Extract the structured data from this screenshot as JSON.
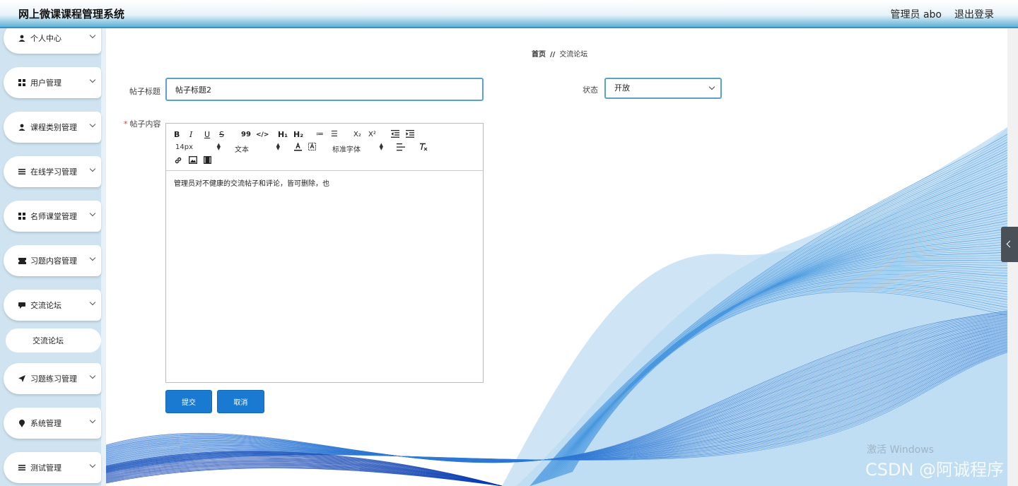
{
  "app_title": "网上微课课程管理系统",
  "header": {
    "user": "管理员 abo",
    "logout": "退出登录"
  },
  "sidebar": {
    "items": [
      {
        "label": "个人中心",
        "icon": "user-icon"
      },
      {
        "label": "用户管理",
        "icon": "grid-icon"
      },
      {
        "label": "课程类别管理",
        "icon": "user-icon"
      },
      {
        "label": "在线学习管理",
        "icon": "list-icon"
      },
      {
        "label": "名师课堂管理",
        "icon": "grid-icon"
      },
      {
        "label": "习题内容管理",
        "icon": "ticket-icon"
      },
      {
        "label": "交流论坛",
        "icon": "chat-icon"
      },
      {
        "label": "习题练习管理",
        "icon": "send-icon"
      },
      {
        "label": "系统管理",
        "icon": "pin-icon"
      },
      {
        "label": "测试管理",
        "icon": "list-icon"
      }
    ],
    "sub_item": "交流论坛"
  },
  "breadcrumb": {
    "home": "首页",
    "separator": "//",
    "current": "交流论坛"
  },
  "form": {
    "title_label": "帖子标题",
    "title_value": "帖子标题2",
    "status_label": "状态",
    "status_value": "开放",
    "content_label": "帖子内容",
    "required_mark": "*",
    "content_value": "管理员对不健康的交流帖子和评论，皆可删除，也"
  },
  "editor_toolbar": {
    "bold": "B",
    "italic": "I",
    "underline": "U",
    "strike": "S",
    "quote": "99",
    "code": "</>",
    "h1": "H₁",
    "h2": "H₂",
    "ordered_list": "≔",
    "bullet_list": "☰",
    "subscript": "X₂",
    "superscript": "X²",
    "font_size": "14px",
    "header_select": "文本",
    "font_family": "标准字体"
  },
  "buttons": {
    "submit": "提交",
    "cancel": "取消"
  },
  "watermark": {
    "activate": "激活 Windows",
    "csdn": "CSDN @阿诚程序"
  },
  "colors": {
    "header_bottom": "#2e95c6",
    "sidebar_bg": "#cfe4f0",
    "button": "#1a79d0",
    "input_border": "#5aa3c7",
    "wave": "#2a6fd0"
  }
}
